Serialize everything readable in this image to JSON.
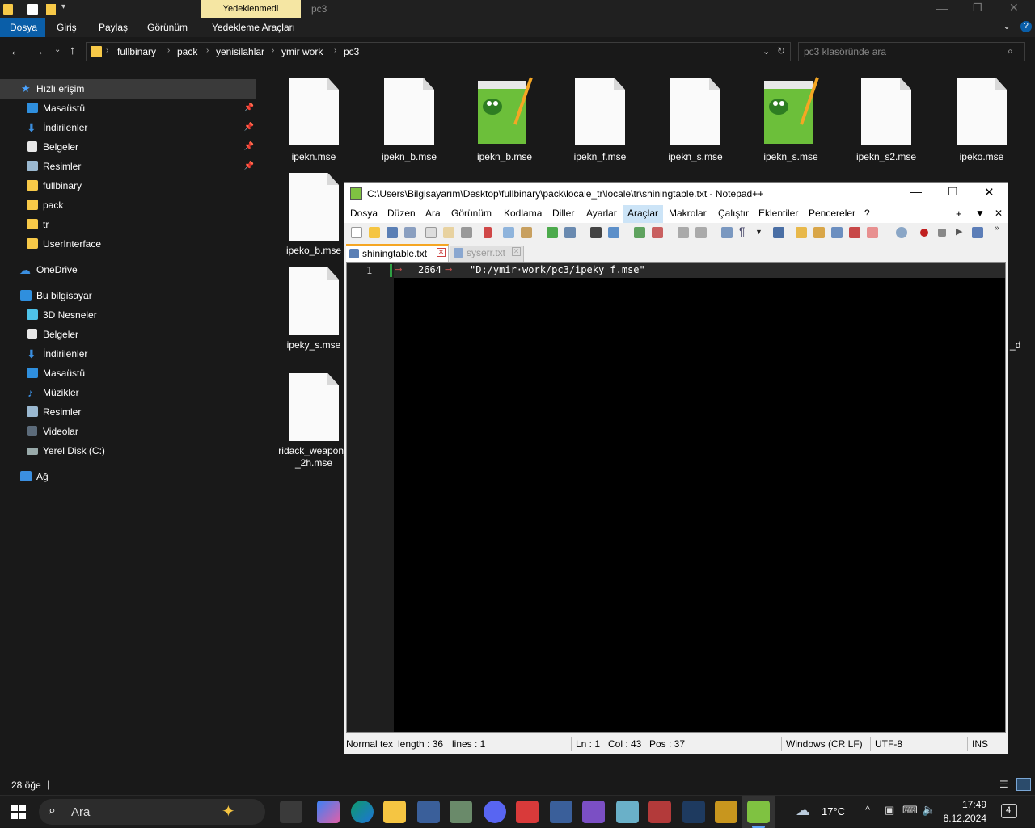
{
  "explorer": {
    "context_tab": "Yedeklenmedi",
    "window_title": "pc3",
    "ribbon_tabs": [
      "Dosya",
      "Giriş",
      "Paylaş",
      "Görünüm",
      "Yedekleme Araçları"
    ],
    "breadcrumb": [
      "fullbinary",
      "pack",
      "yenisilahlar",
      "ymir work",
      "pc3"
    ],
    "search_placeholder": "pc3 klasöründe ara",
    "nav": {
      "quick_access": "Hızlı erişim",
      "quick_items": [
        "Masaüstü",
        "İndirilenler",
        "Belgeler",
        "Resimler",
        "fullbinary",
        "pack",
        "tr",
        "UserInterface"
      ],
      "onedrive": "OneDrive",
      "this_pc": "Bu bilgisayar",
      "pc_items": [
        "3D Nesneler",
        "Belgeler",
        "İndirilenler",
        "Masaüstü",
        "Müzikler",
        "Resimler",
        "Videolar",
        "Yerel Disk (C:)"
      ],
      "network": "Ağ"
    },
    "files_row1": [
      "ipekn.mse",
      "ipekn_b.mse",
      "ipekn_b.mse",
      "ipekn_f.mse",
      "ipekn_s.mse",
      "ipekn_s.mse",
      "ipekn_s2.mse",
      "ipeko.mse"
    ],
    "files_col": [
      "ipeko_b.mse",
      "ipeky_s.mse",
      "ridack_weapon_\n_2h.mse"
    ],
    "partial_label": "_d",
    "item_count": "28 öğe"
  },
  "notepad": {
    "title": "C:\\Users\\Bilgisayarım\\Desktop\\fullbinary\\pack\\locale_tr\\locale\\tr\\shiningtable.txt - Notepad++",
    "menu": [
      "Dosya",
      "Düzen",
      "Ara",
      "Görünüm",
      "Kodlama",
      "Diller",
      "Ayarlar",
      "Araçlar",
      "Makrolar",
      "Çalıştır",
      "Eklentiler",
      "Pencereler",
      "?"
    ],
    "tabs": [
      {
        "label": "shiningtable.txt",
        "active": true
      },
      {
        "label": "syserr.txt",
        "active": false
      }
    ],
    "line_number": "1",
    "line_number_prefix": "2664",
    "line_content": "\"D:/ymir·work/pc3/ipeky_f.mse\"",
    "status": {
      "lang": "Normal tex",
      "length": "length : 36",
      "lines": "lines : 1",
      "ln": "Ln : 1",
      "col": "Col : 43",
      "pos": "Pos : 37",
      "eol": "Windows (CR LF)",
      "encoding": "UTF-8",
      "mode": "INS"
    }
  },
  "taskbar": {
    "search": "Ara",
    "weather": "17°C",
    "time": "17:49",
    "date": "8.12.2024",
    "notif_count": "4"
  },
  "colors": {
    "accent": "#0078d4",
    "folder": "#f7c948",
    "notepad_green": "#7fc241"
  }
}
